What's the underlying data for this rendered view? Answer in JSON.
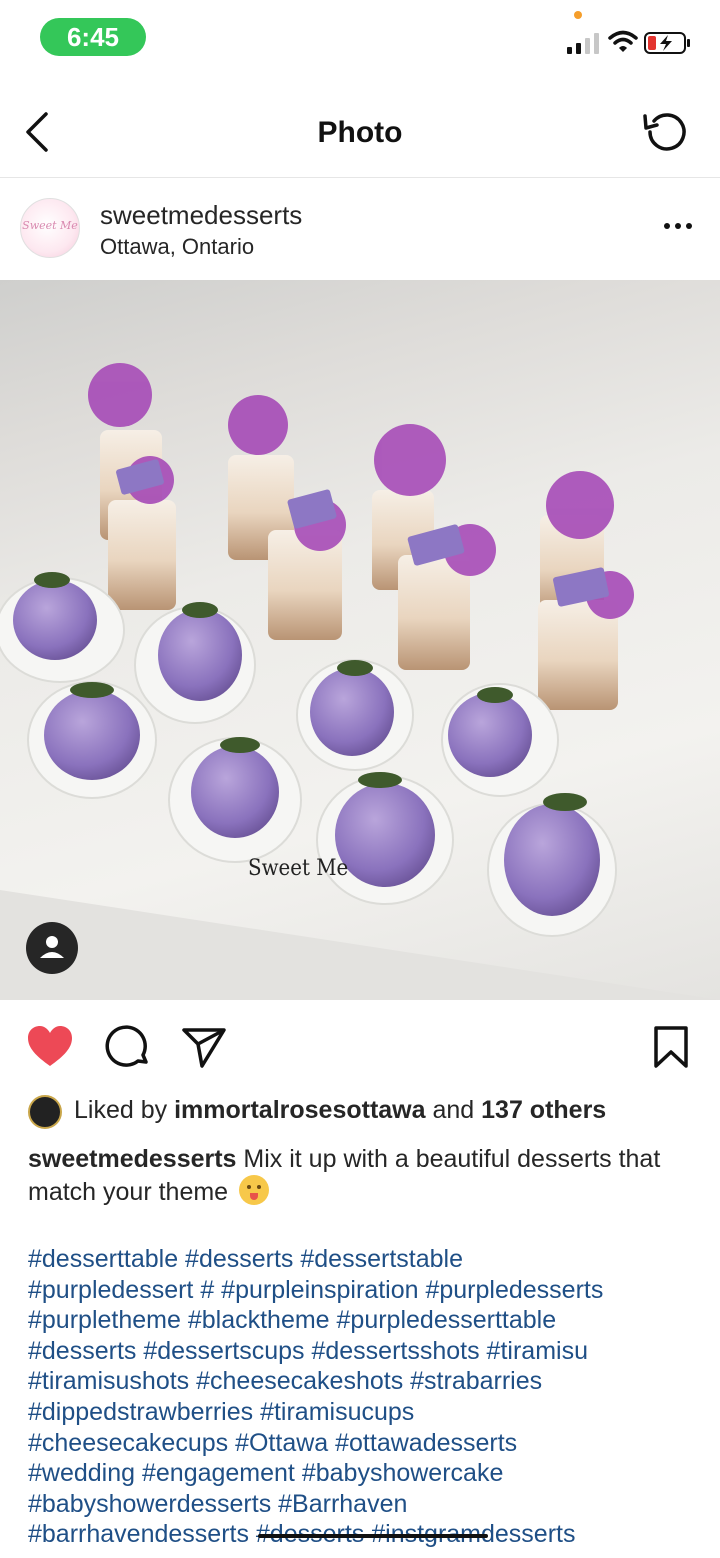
{
  "status_bar": {
    "time": "6:45"
  },
  "nav": {
    "title": "Photo"
  },
  "post": {
    "username": "sweetmedesserts",
    "location": "Ottawa, Ontario",
    "avatar_text": "Sweet Me",
    "watermark": "Sweet Me"
  },
  "colors": {
    "like": "#ed4956",
    "hashtag": "#1f4f86",
    "time_pill": "#34c759"
  },
  "likes": {
    "prefix": "Liked by ",
    "user": "immortalrosesottawa",
    "middle": " and ",
    "others": "137 others"
  },
  "caption": {
    "username": "sweetmedesserts",
    "text": " Mix it up with a beautiful desserts that match your theme "
  },
  "hashtag_lines": [
    "#desserttable #desserts #dessertstable",
    "#purpledessert # #purpleinspiration #purpledesserts",
    "#purpletheme #blacktheme  #purpledesserttable",
    "#desserts #dessertscups #dessertsshots #tiramisu",
    "#tiramisushots #cheesecakeshots  #strabarries",
    "#dippedstrawberries  #tiramisucups",
    "#cheesecakecups #Ottawa #ottawadesserts",
    "#wedding #engagement #babyshowercake",
    "#babyshowerdesserts #Barrhaven",
    "#barrhavendesserts #desserts #instgramdesserts"
  ],
  "icons": {
    "back": "chevron-left-icon",
    "refresh": "refresh-icon",
    "more": "more-icon",
    "like": "heart-icon",
    "comment": "comment-icon",
    "share": "send-icon",
    "save": "bookmark-icon",
    "tag": "person-icon"
  }
}
